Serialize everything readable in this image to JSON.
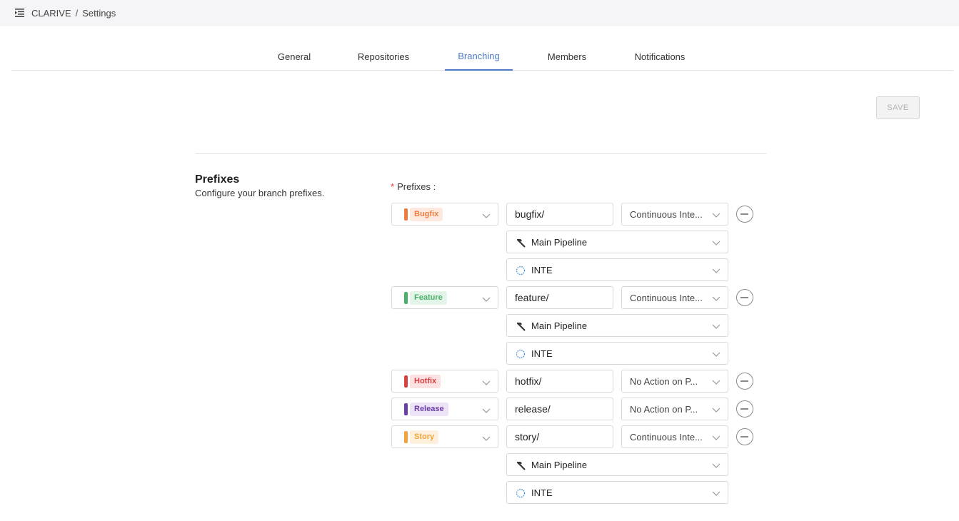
{
  "header": {
    "app_name": "CLARIVE",
    "separator": "/",
    "page": "Settings"
  },
  "tabs": [
    {
      "label": "General",
      "active": false
    },
    {
      "label": "Repositories",
      "active": false
    },
    {
      "label": "Branching",
      "active": true
    },
    {
      "label": "Members",
      "active": false
    },
    {
      "label": "Notifications",
      "active": false
    }
  ],
  "save_label": "SAVE",
  "section": {
    "title": "Prefixes",
    "description": "Configure your branch prefixes."
  },
  "field_label": "Prefixes",
  "required_marker": "*",
  "prefixes": [
    {
      "type": "Bugfix",
      "color": "#f07b3f",
      "tag_bg": "#fde9df",
      "prefix": "bugfix/",
      "action": "Continuous Inte...",
      "pipeline": "Main Pipeline",
      "environment": "INTE"
    },
    {
      "type": "Feature",
      "color": "#4caf6a",
      "tag_bg": "#e3f5e8",
      "prefix": "feature/",
      "action": "Continuous Inte...",
      "pipeline": "Main Pipeline",
      "environment": "INTE"
    },
    {
      "type": "Hotfix",
      "color": "#d94040",
      "tag_bg": "#fbe1e1",
      "prefix": "hotfix/",
      "action": "No Action on P...",
      "pipeline": null,
      "environment": null
    },
    {
      "type": "Release",
      "color": "#6b3fa6",
      "tag_bg": "#ece3f6",
      "prefix": "release/",
      "action": "No Action on P...",
      "pipeline": null,
      "environment": null
    },
    {
      "type": "Story",
      "color": "#f2a43a",
      "tag_bg": "#fdf0dc",
      "prefix": "story/",
      "action": "Continuous Inte...",
      "pipeline": "Main Pipeline",
      "environment": "INTE"
    }
  ],
  "icons": {
    "pipeline": "hammer-icon",
    "environment": "dotted-circle-icon",
    "remove": "minus-circle-icon",
    "menu": "menu-icon"
  }
}
